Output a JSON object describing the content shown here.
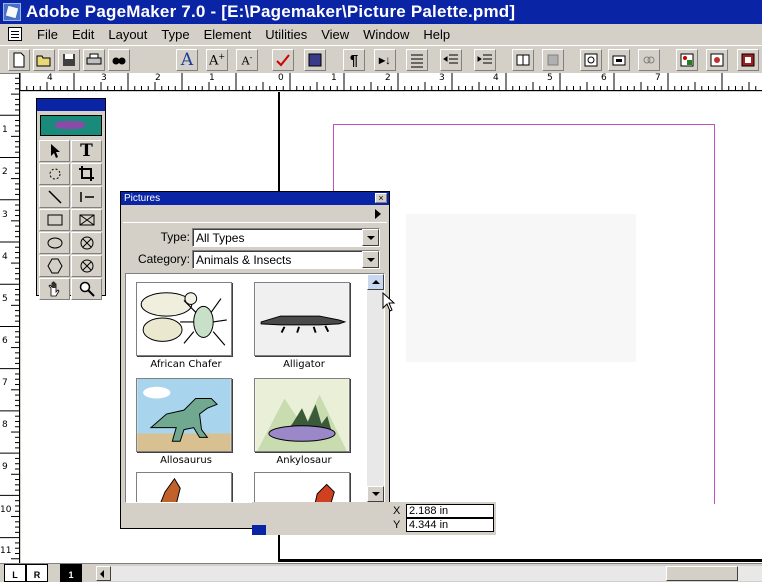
{
  "window": {
    "title": "Adobe PageMaker 7.0 - [E:\\Pagemaker\\Picture Palette.pmd]"
  },
  "menu": [
    "File",
    "Edit",
    "Layout",
    "Type",
    "Element",
    "Utilities",
    "View",
    "Window",
    "Help"
  ],
  "toolbar_icons": [
    "new-icon",
    "open-icon",
    "save-icon",
    "print-icon",
    "find-icon",
    "font-icon",
    "increase-font-icon",
    "decrease-font-icon",
    "spellcheck-icon",
    "fill-icon",
    "paragraph-icon",
    "place-icon",
    "bullets-icon",
    "indent-icon",
    "outdent-icon",
    "styles-icon",
    "colors-icon",
    "frame-icon",
    "layers-icon",
    "links-icon",
    "scripts-icon",
    "pictures-icon",
    "quit-icon"
  ],
  "rulers": {
    "horizontal": [
      "4",
      "3",
      "2",
      "1",
      "0",
      "1",
      "2",
      "3",
      "4",
      "5",
      "6",
      "7"
    ],
    "vertical": [
      "1",
      "2",
      "3",
      "4",
      "5",
      "6",
      "7",
      "8",
      "9",
      "10",
      "11"
    ]
  },
  "toolbox": {
    "tools": [
      "pointer-tool-icon",
      "text-tool-icon",
      "rotate-tool-icon",
      "crop-tool-icon",
      "line-tool-icon",
      "constrained-line-tool-icon",
      "rectangle-tool-icon",
      "rectangle-frame-tool-icon",
      "ellipse-tool-icon",
      "ellipse-frame-tool-icon",
      "polygon-tool-icon",
      "polygon-frame-tool-icon",
      "hand-tool-icon",
      "zoom-tool-icon"
    ]
  },
  "pictures_palette": {
    "title": "Pictures",
    "close": "×",
    "type_label": "Type:",
    "type_value": "All Types",
    "category_label": "Category:",
    "category_value": "Animals & Insects",
    "items": [
      {
        "caption": "African Chafer"
      },
      {
        "caption": "Alligator"
      },
      {
        "caption": "Allosaurus"
      },
      {
        "caption": "Ankylosaur"
      }
    ]
  },
  "control_palette": {
    "x_label": "X",
    "x_value": "2.188 in",
    "y_label": "Y",
    "y_value": "4.344 in"
  },
  "page_icons": [
    "L",
    "R",
    "1"
  ]
}
